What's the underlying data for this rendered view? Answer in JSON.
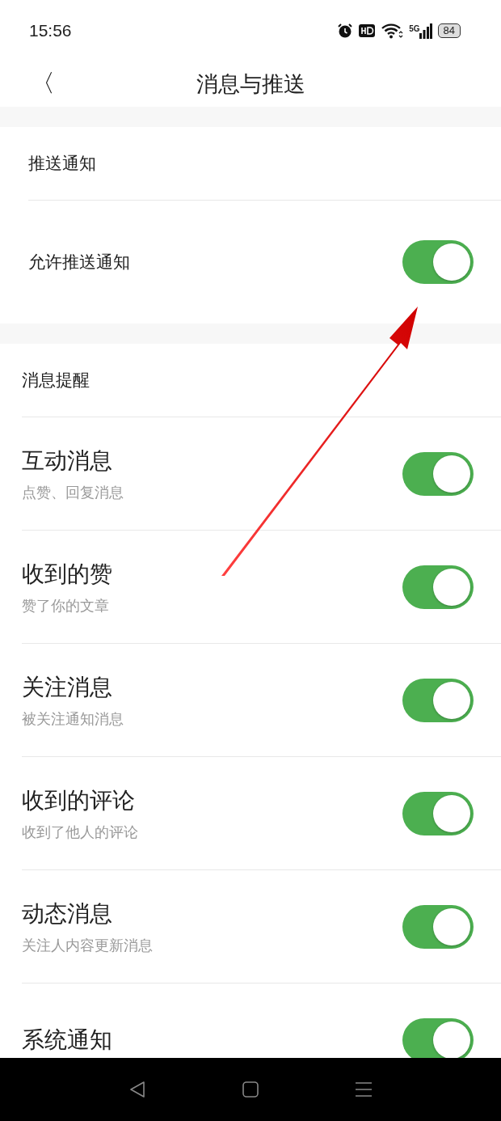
{
  "status_bar": {
    "time": "15:56",
    "battery": "84",
    "network": "5G"
  },
  "header": {
    "back": "〈",
    "title": "消息与推送"
  },
  "sections": [
    {
      "title": "推送通知",
      "items": [
        {
          "title": "允许推送通知",
          "on": true
        }
      ]
    },
    {
      "title": "消息提醒",
      "items": [
        {
          "title": "互动消息",
          "subtitle": "点赞、回复消息",
          "on": true
        },
        {
          "title": "收到的赞",
          "subtitle": "赞了你的文章",
          "on": true
        },
        {
          "title": "关注消息",
          "subtitle": "被关注通知消息",
          "on": true
        },
        {
          "title": "收到的评论",
          "subtitle": "收到了他人的评论",
          "on": true
        },
        {
          "title": "动态消息",
          "subtitle": "关注人内容更新消息",
          "on": true
        },
        {
          "title": "系统通知",
          "on": true
        }
      ]
    }
  ]
}
